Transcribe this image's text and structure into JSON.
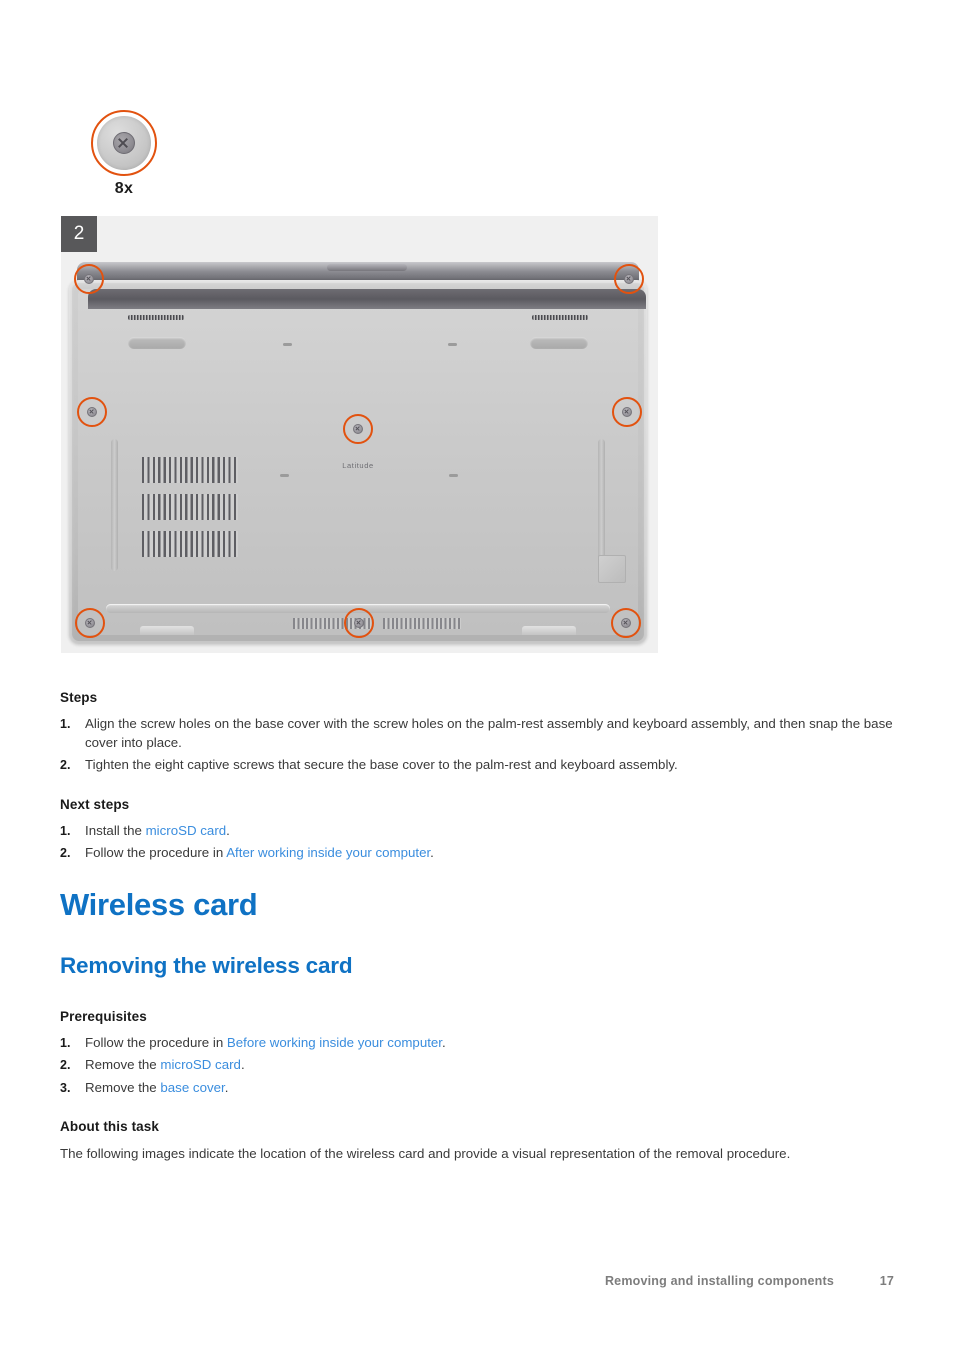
{
  "figure": {
    "legend": {
      "icon": "captive-screw",
      "count_label": "8x"
    },
    "step_badge": "2",
    "laptop_brand": "Latitude",
    "highlight_color": "#e2520f",
    "screw_highlight_count": 8
  },
  "sections": [
    {
      "id": "steps",
      "heading": "Steps",
      "items": [
        {
          "num": "1.",
          "text": "Align the screw holes on the base cover with the screw holes on the palm-rest assembly and keyboard assembly, and then snap the base cover into place."
        },
        {
          "num": "2.",
          "text": "Tighten the eight captive screws that secure the base cover to the palm-rest and keyboard assembly."
        }
      ]
    },
    {
      "id": "next-steps",
      "heading": "Next steps",
      "items": [
        {
          "num": "1.",
          "pre": "Install the ",
          "link": "microSD card",
          "post": "."
        },
        {
          "num": "2.",
          "pre": "Follow the procedure in ",
          "link": "After working inside your computer",
          "post": "."
        }
      ]
    }
  ],
  "title": {
    "major": "Wireless card",
    "minor": "Removing the wireless card",
    "color": "#0f72c4"
  },
  "prerequisites": {
    "heading": "Prerequisites",
    "items": [
      {
        "num": "1.",
        "pre": "Follow the procedure in ",
        "link": "Before working inside your computer",
        "post": "."
      },
      {
        "num": "2.",
        "pre": "Remove the ",
        "link": "microSD card",
        "post": "."
      },
      {
        "num": "3.",
        "pre": "Remove the ",
        "link": "base cover",
        "post": "."
      }
    ]
  },
  "about": {
    "heading": "About this task",
    "text": "The following images indicate the location of the wireless card and provide a visual representation of the removal procedure."
  },
  "footer": {
    "chapter": "Removing and installing components",
    "page": "17"
  }
}
